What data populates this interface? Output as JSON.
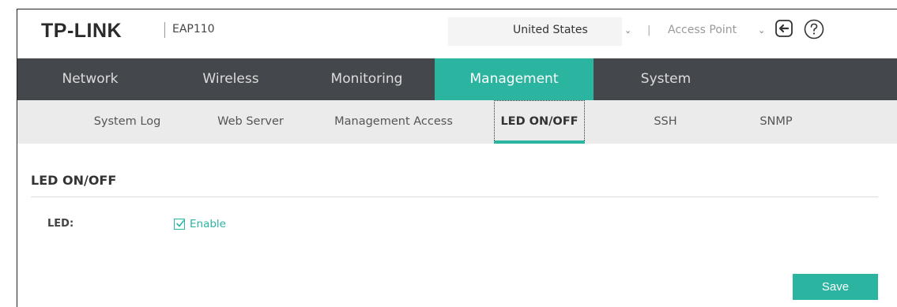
{
  "header": {
    "logo": "TP-LINK",
    "model": "EAP110",
    "country": "United States",
    "separator": "|",
    "mode": "Access Point"
  },
  "main_nav": {
    "items": [
      {
        "label": "Network"
      },
      {
        "label": "Wireless"
      },
      {
        "label": "Monitoring"
      },
      {
        "label": "Management",
        "active": true
      },
      {
        "label": "System"
      }
    ]
  },
  "sub_nav": {
    "items": [
      {
        "label": "System Log"
      },
      {
        "label": "Web Server"
      },
      {
        "label": "Management Access"
      },
      {
        "label": "LED ON/OFF",
        "active": true
      },
      {
        "label": "SSH"
      },
      {
        "label": "SNMP"
      }
    ]
  },
  "section": {
    "title": "LED ON/OFF",
    "led_label": "LED:",
    "enable_label": "Enable",
    "enable_checked": true
  },
  "actions": {
    "save_label": "Save"
  },
  "colors": {
    "accent": "#2bb4a0",
    "nav_bg": "#44484c",
    "subnav_bg": "#ebebeb"
  },
  "icons": {
    "logout": "logout-icon",
    "help": "help-icon",
    "dropdown": "chevron-down-icon",
    "check": "checkmark-icon"
  }
}
